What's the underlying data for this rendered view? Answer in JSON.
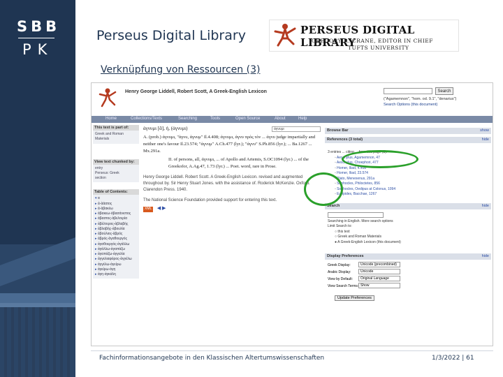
{
  "branding": {
    "logo_top": "SBB",
    "logo_bottom": "PK"
  },
  "slide": {
    "title": "Perseus Digital Library",
    "subtitle": "Verknüpfung von Ressourcen (3)",
    "footer": "Fachinformationsangebote in den Klassischen Altertumswissenschaften",
    "date_page": "1/3/2022 | 61"
  },
  "banner": {
    "title": "PERSEUS DIGITAL LIBRARY",
    "editor": "GREGORY R. CRANE, EDITOR IN CHIEF",
    "university": "TUFTS UNIVERSITY"
  },
  "screenshot": {
    "work_title": "Henry George Liddell, Robert Scott, A Greek-English Lexicon",
    "search_button": "Search",
    "search_hint": "(\"Agamemnon\", \"hom. od. 9.1\", \"denarius\")",
    "search_options": "Search Options (this document)",
    "nav": [
      "Home",
      "Collections/Texts",
      "Searching",
      "Tools",
      "Open Source",
      "About",
      "Help"
    ],
    "left": {
      "part_of_head": "This text is part of:",
      "part_of_items": [
        "Greek and Roman Materials"
      ],
      "view_chunked_head": "View text chunked by:",
      "view_chunked_items": [
        "entry",
        "Perseus: Greek",
        "section"
      ],
      "toc_head": "Table of Contents:",
      "toc_items": [
        "α",
        "ἀ-ἀάατος",
        "ἀ-ἀβακέω",
        "ἀβακεω-ἀβασάνιστος",
        "ἀβαστος-ἀβελτερία",
        "ἀβέλτερος-ἀβλαβής",
        "ἀβλαβής-ἀβουλία",
        "ἀβούλιος-ἀβρός",
        "ἀβρός-ἀγαθοεργός",
        "ἀγαθοεργός-ἀγάλλω",
        "ἀγάλλω-ἀγαπάζω",
        "ἀγαπάζω-ἀγγελία",
        "ἀγγελιαφόρος-ἀγγέλω",
        "ἀγγέλω-ἀγείρω",
        "ἀγείρω-ἀγη",
        "ἀγη-ἀγκάλη"
      ]
    },
    "main": {
      "search_field": "ἀγνυμι",
      "headword": "ἀγνυμι [ᾱ], ἡ, (ἀγνυμι)",
      "sense_1": "A. (prob.) ἀγνυμι, \"ἀγνυ, ἀγνυμ\" Il.4.408; ἀγνυμι, ἀγνυ πρὸς τὸν ... ἀγνυ judge impartially and neither one's favour Il.23.574; \"ἀγνυμ\" A.Ch.477 (lyr.); \"ἀγνυ\" S.Ph.856 (lyr.); ... Ba.1267 ... Mx.291a.",
      "sense_2": "II. of persons, all, ἀγνυμι, ... of Apollo and Artemis, S.OC1094 (lyr.) ... of the Greekofor, A.Ag.47, 1.73 (lyr.) ... Poet. word, rare in Prose.",
      "citation": "Henry George Liddell. Robert Scott. A Greek-English Lexicon. revised and augmented throughout by. Sir Henry Stuart Jones. with the assistance of. Roderick McKenzie. Oxford. Clarendon Press. 1940.",
      "funding": "The National Science Foundation provided support for entering this text.",
      "xml_label": "XML"
    },
    "right": {
      "browse_head": "Browse Bar",
      "browse_toggle": "show",
      "refs_head": "References (3 total)",
      "refs_toggle": "hide",
      "refs": [
        "3 entries ... citing ... from this page (3):",
        "Aeschylus, Agamemnon, 47",
        "Aeschylus, Choephori, 477",
        "Homer, Iliad, 4.408",
        "Homer, Iliad, 23.574",
        "Plato, Menexenus, 291a",
        "Sophocles, Philoctetes, 856",
        "Sophocles, Oedipus at Colonus, 1094",
        "Euripides, Bacchae, 1267"
      ],
      "search_head": "Search",
      "search_toggle": "hide",
      "search_options": [
        "Searching in English. More search options",
        "Limit Search to:",
        "this text",
        "Greek and Roman Materials",
        "A Greek-English Lexicon (this document)"
      ],
      "prefs_head": "Display Preferences",
      "prefs_toggle": "hide",
      "prefs": [
        {
          "label": "Greek Display:",
          "value": "Unicode (precombined)"
        },
        {
          "label": "Arabic Display:",
          "value": "Unicode"
        },
        {
          "label": "View by Default:",
          "value": "Original Language"
        },
        {
          "label": "View Search Terms:",
          "value": "Show"
        }
      ],
      "update_button": "Update Preferences"
    }
  }
}
